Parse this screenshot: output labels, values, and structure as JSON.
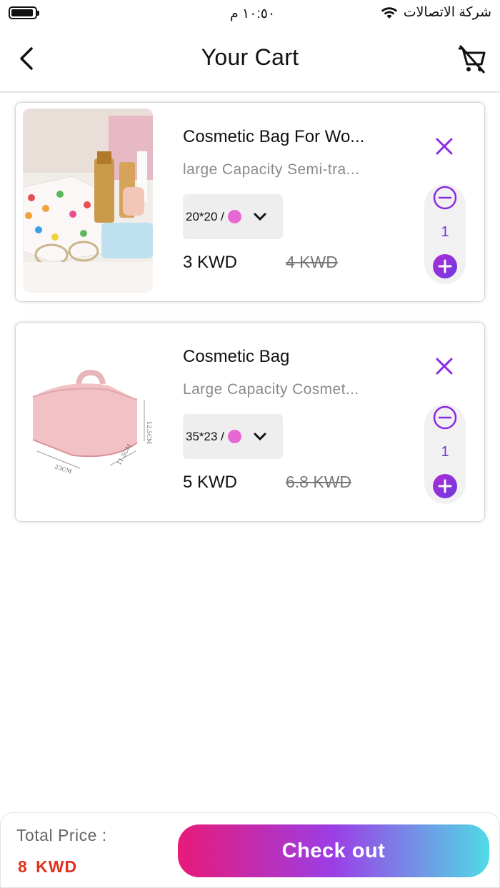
{
  "status_bar": {
    "time": "١٠:٥٠ م",
    "carrier": "شركة الاتصالات"
  },
  "header": {
    "title": "Your Cart"
  },
  "items": [
    {
      "name": "Cosmetic Bag For Wo...",
      "description": "large Capacity Semi-tra...",
      "variant": "20*20 /",
      "variant_color": "#e667d4",
      "price": "3 KWD",
      "old_price": "4 KWD",
      "quantity": "1"
    },
    {
      "name": "Cosmetic Bag",
      "description": "Large Capacity Cosmet...",
      "variant": "35*23 /",
      "variant_color": "#e667d4",
      "price": "5 KWD",
      "old_price": "6.8 KWD",
      "quantity": "1"
    }
  ],
  "footer": {
    "total_label": "Total Price :",
    "total_value": "8  KWD",
    "checkout_label": "Check out"
  },
  "colors": {
    "accent": "#9b3ee6",
    "total": "#e0301e",
    "remove": "#8a2be2"
  }
}
